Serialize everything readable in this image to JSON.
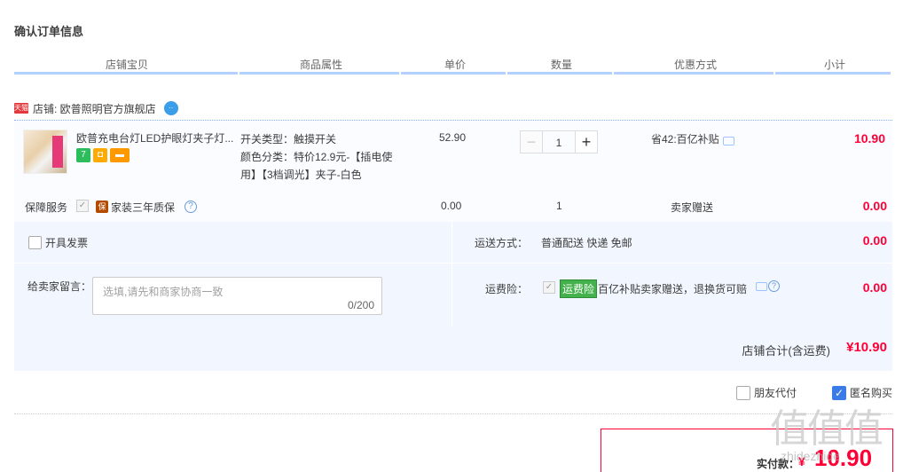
{
  "title": "确认订单信息",
  "columns": [
    "店铺宝贝",
    "商品属性",
    "单价",
    "数量",
    "优惠方式",
    "小计"
  ],
  "shop": {
    "badge": "天猫",
    "name": "店铺: 欧普照明官方旗舰店"
  },
  "item": {
    "title": "欧普充电台灯LED护眼灯夹子灯...",
    "attr_line1": "开关类型：触摸开关",
    "attr_line2": "颜色分类：特价12.9元-【插电使用】【3档调光】夹子-白色",
    "price": "52.90",
    "qty": "1",
    "qty_minus": "−",
    "qty_plus": "+",
    "discount": "省42:百亿补贴",
    "subtotal": "10.90"
  },
  "guarantee": {
    "label": "保障服务",
    "check": "✓",
    "badge": "保",
    "text": "家装三年质保",
    "help": "?",
    "price": "0.00",
    "qty": "1",
    "method": "卖家赠送",
    "subtotal": "0.00"
  },
  "invoice_label": "开具发票",
  "note": {
    "label": "给卖家留言：",
    "placeholder": "选填,请先和商家协商一致",
    "count": "0/200"
  },
  "shipping": {
    "label": "运送方式：",
    "value": "普通配送 快递 免邮",
    "price": "0.00"
  },
  "insurance": {
    "label": "运费险：",
    "check": "✓",
    "tag": "运费险",
    "text": "百亿补贴卖家赠送，退换货可赔",
    "help": "?",
    "price": "0.00"
  },
  "shop_total": {
    "label": "店铺合计(含运费)",
    "value": "¥10.90"
  },
  "friend_pay_label": "朋友代付",
  "anonymous_label": "匿名购买",
  "anonymous_check": "✓",
  "payment": {
    "label": "实付款：",
    "symbol": "¥",
    "value": "10.90"
  },
  "watermark": "值值值",
  "watermark_sub": "zhidezhide",
  "colors": {
    "accent_red": "#ff0036",
    "header_border": "#b2d1ff",
    "panel_bg": "#f2f7ff"
  }
}
